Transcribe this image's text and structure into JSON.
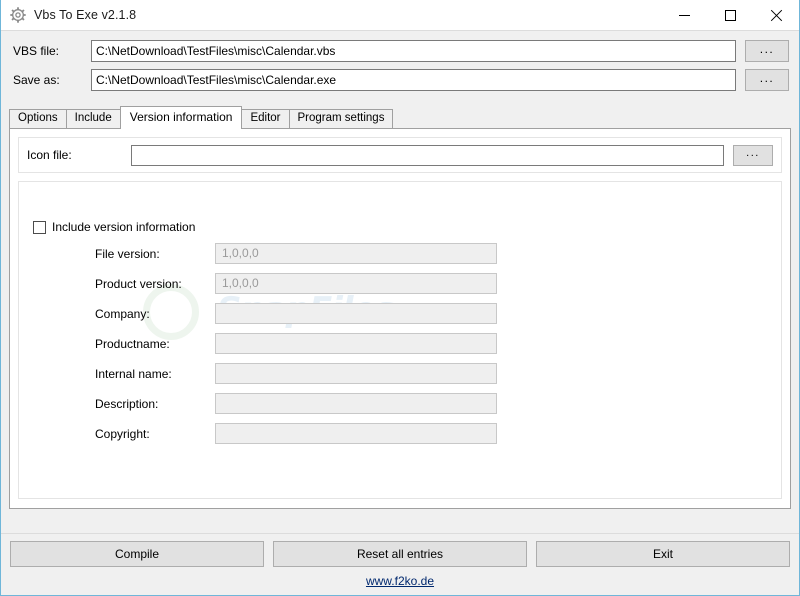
{
  "window": {
    "title": "Vbs To Exe v2.1.8",
    "icon": "gear-icon",
    "controls": {
      "minimize": "minimize-icon",
      "maximize": "maximize-icon",
      "close": "close-icon"
    }
  },
  "file_fields": [
    {
      "label": "VBS file:",
      "value": "C:\\NetDownload\\TestFiles\\misc\\Calendar.vbs",
      "browse_label": "..."
    },
    {
      "label": "Save as:",
      "value": "C:\\NetDownload\\TestFiles\\misc\\Calendar.exe",
      "browse_label": "..."
    }
  ],
  "tabs": [
    {
      "label": "Options",
      "active": false
    },
    {
      "label": "Include",
      "active": false
    },
    {
      "label": "Version information",
      "active": true
    },
    {
      "label": "Editor",
      "active": false
    },
    {
      "label": "Program settings",
      "active": false
    }
  ],
  "icon_file": {
    "label": "Icon file:",
    "value": "",
    "browse_label": "..."
  },
  "version_panel": {
    "checkbox": {
      "label": "Include version information",
      "checked": false
    },
    "fields": [
      {
        "label": "File version:",
        "value": "1,0,0,0"
      },
      {
        "label": "Product version:",
        "value": "1,0,0,0"
      },
      {
        "label": "Company:",
        "value": ""
      },
      {
        "label": "Productname:",
        "value": ""
      },
      {
        "label": "Internal name:",
        "value": ""
      },
      {
        "label": "Description:",
        "value": ""
      },
      {
        "label": "Copyright:",
        "value": ""
      }
    ]
  },
  "watermark": {
    "text": "SnapFiles"
  },
  "buttons": [
    {
      "label": "Compile"
    },
    {
      "label": "Reset all entries"
    },
    {
      "label": "Exit"
    }
  ],
  "footer": {
    "link": "www.f2ko.de"
  },
  "colors": {
    "window_border": "#6fb6d9",
    "face": "#f0f0f0",
    "button_face": "#e1e1e1",
    "link": "#00286e",
    "disabled_text": "#9a9a9a"
  }
}
